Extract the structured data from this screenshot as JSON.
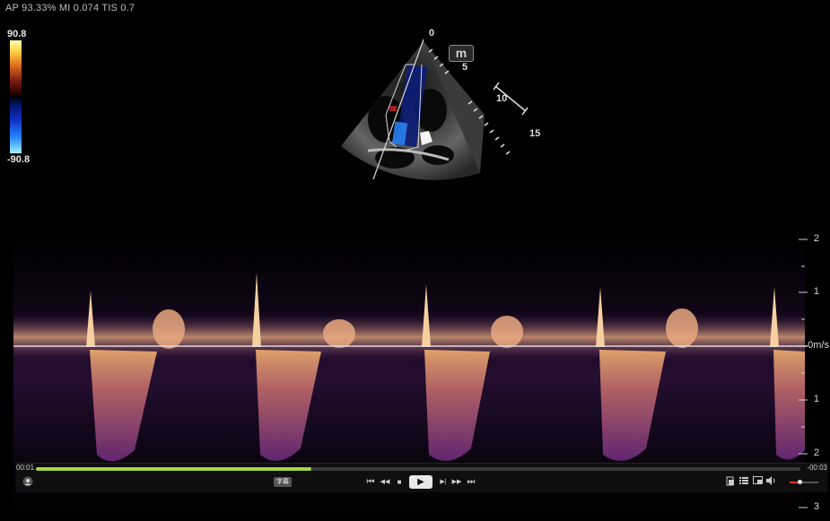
{
  "header": {
    "info": "AP 93.33%  MI 0.074 TIS 0.7"
  },
  "color_scale": {
    "max": "90.8",
    "min": "-90.8"
  },
  "depth_scale": [
    "0",
    "5",
    "10",
    "15"
  ],
  "mode_marker": "m",
  "velocity_axis": {
    "labels": [
      "2",
      "1",
      "0m/s",
      "1",
      "2",
      "3"
    ],
    "values": [
      2,
      1,
      0,
      -1,
      -2,
      -3
    ],
    "unit": "m/s"
  },
  "player": {
    "time_start": "00:01",
    "time_end": "-00:03",
    "progress": 0.36,
    "subtitle_label": "字幕",
    "controls": {
      "prev": "⏮",
      "rewind": "◀◀",
      "stop": "■",
      "play": "▶",
      "step": "▶|",
      "forward": "▶▶",
      "next": "⏭"
    },
    "volume": 0.35
  },
  "colors": {
    "baseline": "#e6d6e8",
    "progress": "#a8d646",
    "volume": "#e03030"
  }
}
